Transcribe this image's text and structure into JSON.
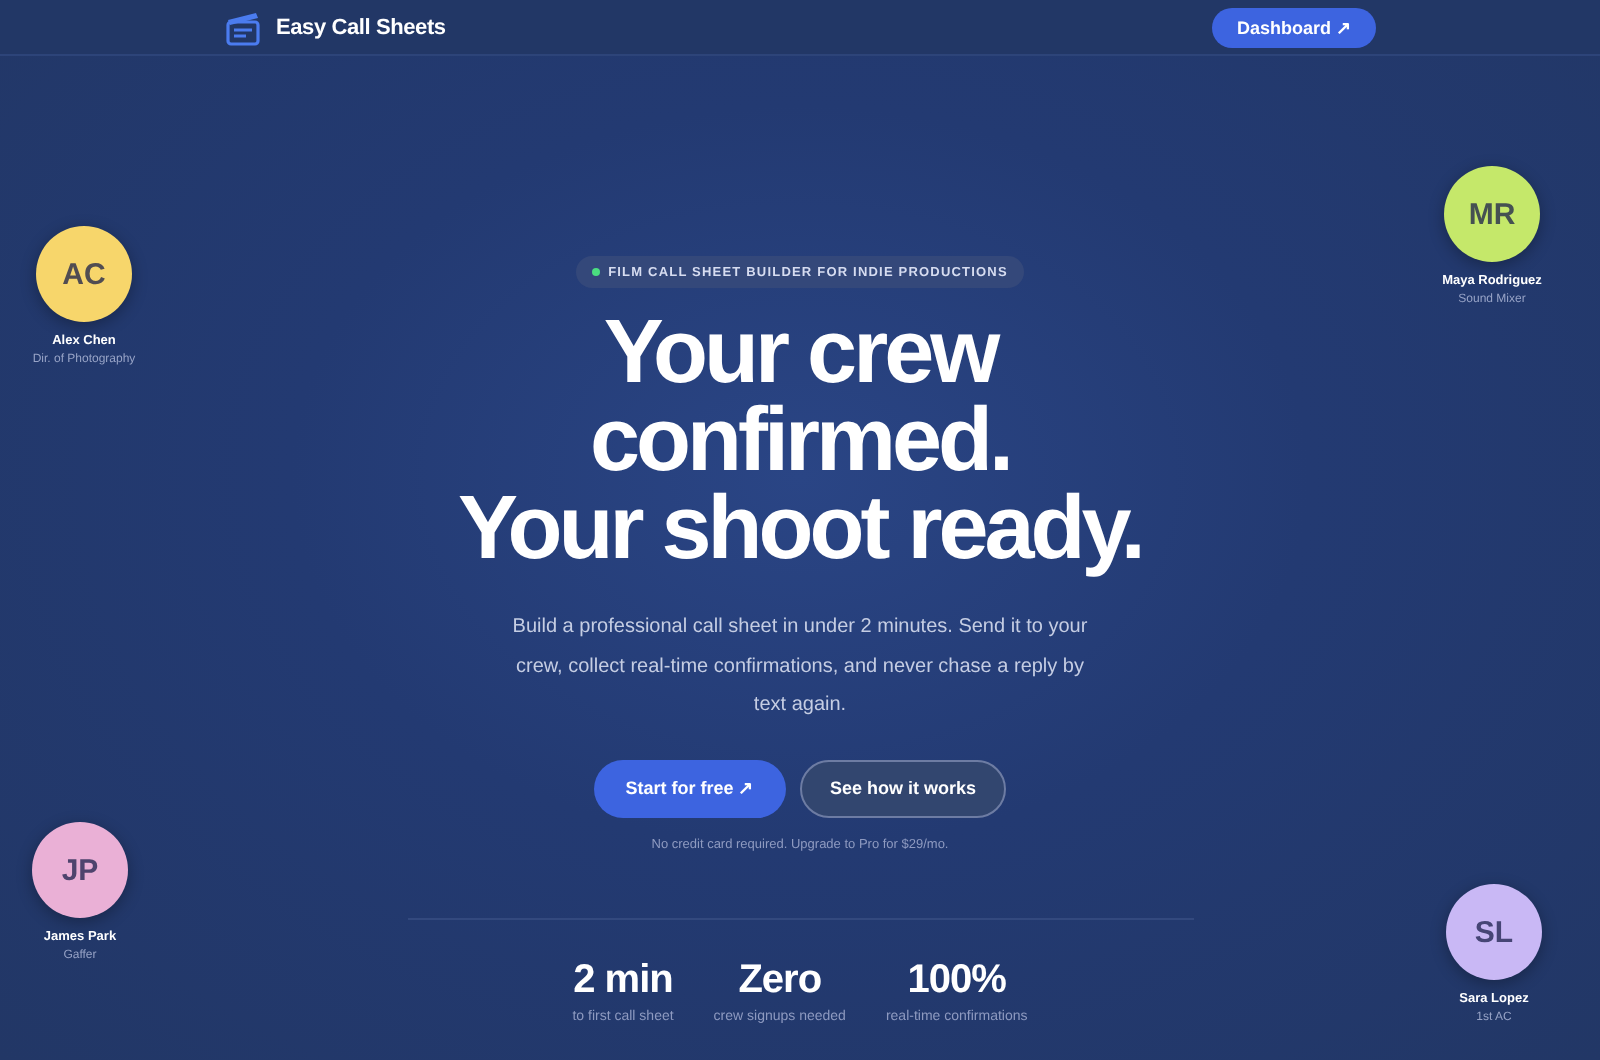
{
  "nav": {
    "brand": "Easy Call Sheets",
    "button": "Dashboard ↗"
  },
  "hero": {
    "badge": "FILM CALL SHEET BUILDER FOR INDIE PRODUCTIONS",
    "headline": [
      "Your crew",
      "confirmed.",
      "Your shoot ready."
    ],
    "subtitle": "Build a professional call sheet in under 2 minutes. Send it to your crew, collect real-time confirmations, and never chase a reply by text again.",
    "primary_button": "Start for free ↗",
    "secondary_button": "See how it works",
    "note": "No credit card required. Upgrade to Pro for $29/mo."
  },
  "stats": [
    {
      "value": "2 min",
      "label": "to first call sheet"
    },
    {
      "value": "Zero",
      "label": "crew signups needed"
    },
    {
      "value": "100%",
      "label": "real-time confirmations"
    }
  ],
  "crew": [
    {
      "initials": "AC",
      "name": "Alex Chen",
      "role": "Dir. of Photography",
      "color": "#f7d66b"
    },
    {
      "initials": "MR",
      "name": "Maya Rodriguez",
      "role": "Sound Mixer",
      "color": "#c5e86a"
    },
    {
      "initials": "JP",
      "name": "James Park",
      "role": "Gaffer",
      "color": "#eab0d6"
    },
    {
      "initials": "SL",
      "name": "Sara Lopez",
      "role": "1st AC",
      "color": "#c9b8f5"
    }
  ]
}
